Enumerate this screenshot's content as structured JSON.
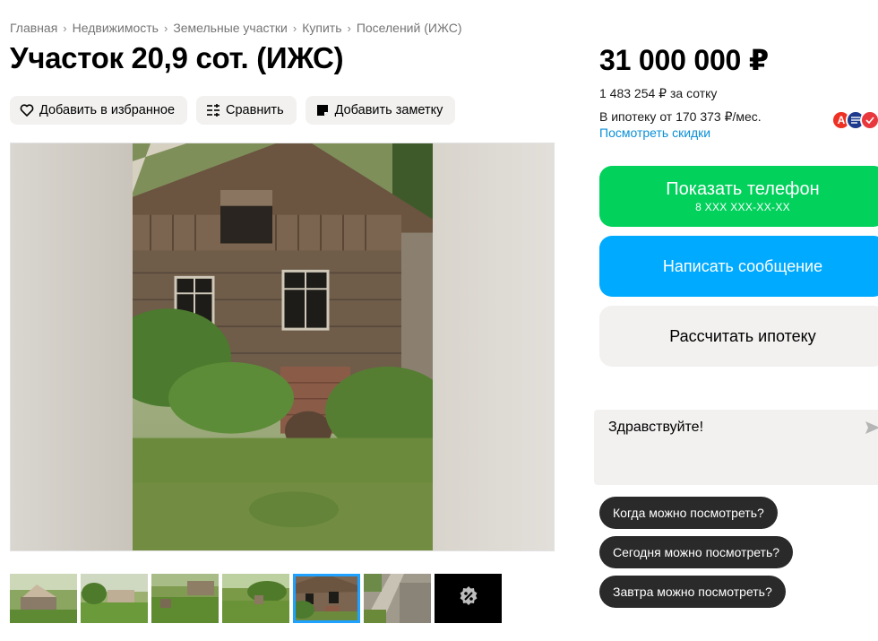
{
  "breadcrumb": [
    "Главная",
    "Недвижимость",
    "Земельные участки",
    "Купить",
    "Поселений (ИЖС)"
  ],
  "title": "Участок 20,9 сот. (ИЖС)",
  "actions": {
    "favorite": "Добавить в избранное",
    "compare": "Сравнить",
    "note": "Добавить заметку"
  },
  "price": {
    "total": "31 000 000 ₽",
    "per_sotka": "1 483 254 ₽ за сотку",
    "mortgage": "В ипотеку от 170 373 ₽/мес.",
    "discounts_link": "Посмотреть скидки"
  },
  "banks": [
    "alfa-bank-icon",
    "sber-bank-icon",
    "vtb-bank-icon"
  ],
  "buttons": {
    "phone": "Показать телефон",
    "phone_mask": "8 XXX XXX-XX-XX",
    "message": "Написать сообщение",
    "mortgage_calc": "Рассчитать ипотеку"
  },
  "chat": {
    "message": "Здравствуйте!"
  },
  "quick_questions": [
    "Когда можно посмотреть?",
    "Сегодня можно посмотреть?",
    "Завтра можно посмотреть?"
  ],
  "thumbnails": {
    "count": 7,
    "active_index": 4
  },
  "colors": {
    "phone_button": "#02d15c",
    "message_button": "#00aaff",
    "link": "#0a8fd6",
    "active_thumb_border": "#1fa2ff"
  }
}
